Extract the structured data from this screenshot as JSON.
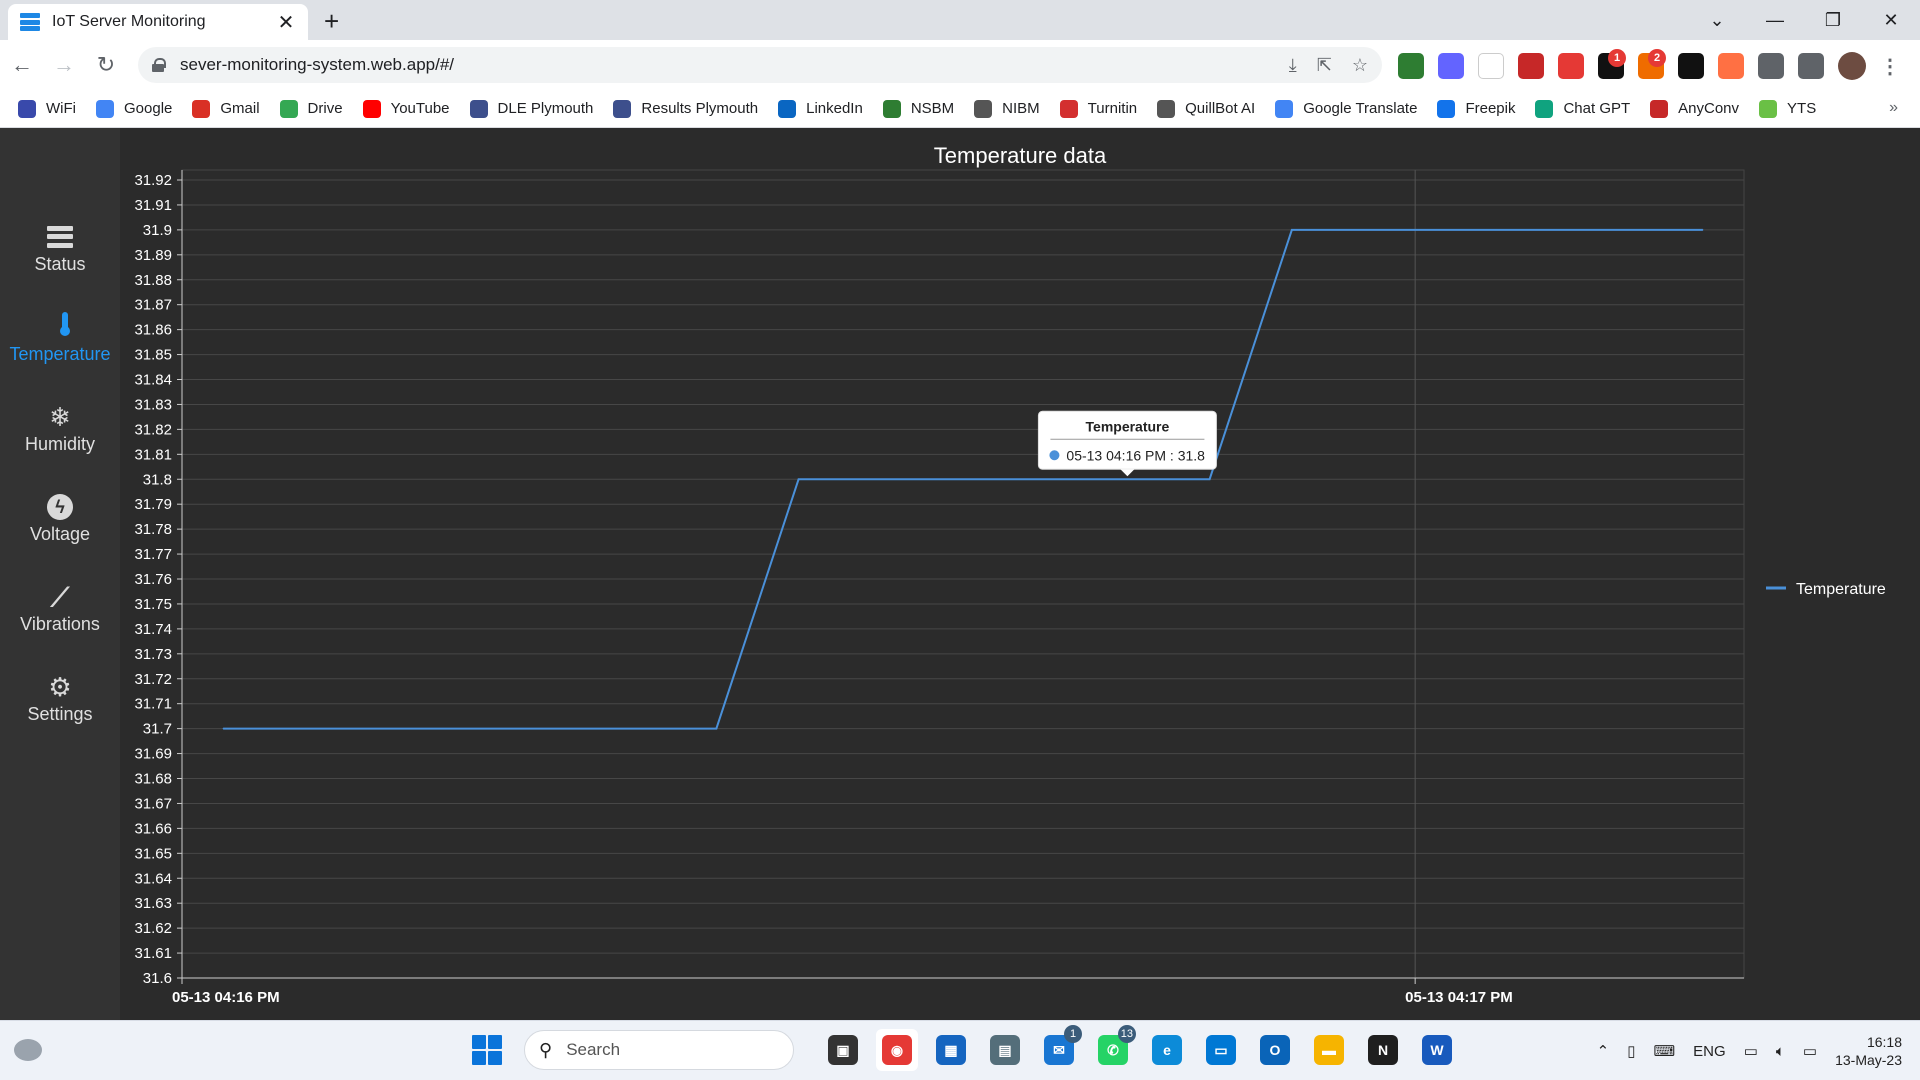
{
  "browser": {
    "tab_title": "IoT Server Monitoring",
    "tab_close": "✕",
    "new_tab": "+",
    "url": "sever-monitoring-system.web.app/#/",
    "window_controls": [
      "⌄",
      "—",
      "❐",
      "✕"
    ],
    "extensions": [
      {
        "icon": "globe-extension-icon",
        "color": "#2e7d32"
      },
      {
        "icon": "mastodon-icon",
        "color": "#6364ff"
      },
      {
        "icon": "notion-n-icon",
        "color": "#ffffff"
      },
      {
        "icon": "video-icon",
        "color": "#c62828"
      },
      {
        "icon": "adblock-icon",
        "color": "#e53935"
      },
      {
        "icon": "black-ext-icon",
        "color": "#111111",
        "badge": "1"
      },
      {
        "icon": "orange-ext-icon",
        "color": "#ef6c00",
        "badge": "2"
      },
      {
        "icon": "chatgpt-ext-icon",
        "color": "#111111"
      },
      {
        "icon": "brave-icon",
        "color": "#ff7043"
      },
      {
        "icon": "puzzle-icon",
        "color": "#5f6368"
      },
      {
        "icon": "sidepanel-icon",
        "color": "#5f6368"
      }
    ],
    "bookmarks": [
      {
        "label": "WiFi",
        "icon": "wifi-icon",
        "color": "#3949ab"
      },
      {
        "label": "Google",
        "icon": "google-icon",
        "color": "#4285f4"
      },
      {
        "label": "Gmail",
        "icon": "gmail-icon",
        "color": "#d93025"
      },
      {
        "label": "Drive",
        "icon": "drive-icon",
        "color": "#34a853"
      },
      {
        "label": "YouTube",
        "icon": "youtube-icon",
        "color": "#ff0000"
      },
      {
        "label": "DLE Plymouth",
        "icon": "plymouth-crest-icon",
        "color": "#3d4f8c"
      },
      {
        "label": "Results Plymouth",
        "icon": "plymouth-crest-icon",
        "color": "#3d4f8c"
      },
      {
        "label": "LinkedIn",
        "icon": "linkedin-icon",
        "color": "#0a66c2"
      },
      {
        "label": "NSBM",
        "icon": "nsbm-icon",
        "color": "#2e7d32"
      },
      {
        "label": "NIBM",
        "icon": "nibm-icon",
        "color": "#555555"
      },
      {
        "label": "Turnitin",
        "icon": "turnitin-icon",
        "color": "#d32f2f"
      },
      {
        "label": "QuillBot AI",
        "icon": "quill-icon",
        "color": "#555555"
      },
      {
        "label": "Google Translate",
        "icon": "translate-icon",
        "color": "#4285f4"
      },
      {
        "label": "Freepik",
        "icon": "freepik-icon",
        "color": "#1273eb"
      },
      {
        "label": "Chat GPT",
        "icon": "chatgpt-icon",
        "color": "#10a37f"
      },
      {
        "label": "AnyConv",
        "icon": "anyconv-icon",
        "color": "#c62828"
      },
      {
        "label": "YTS",
        "icon": "yts-icon",
        "color": "#6ac045"
      }
    ],
    "bookmarks_more": "»"
  },
  "sidebar": {
    "items": [
      {
        "label": "Status",
        "icon": "server-icon",
        "active": false
      },
      {
        "label": "Temperature",
        "icon": "thermometer-icon",
        "active": true
      },
      {
        "label": "Humidity",
        "icon": "snowflake-icon",
        "glyph": "❄",
        "active": false
      },
      {
        "label": "Voltage",
        "icon": "bolt-icon",
        "glyph": "ϟ",
        "active": false
      },
      {
        "label": "Vibrations",
        "icon": "trend-icon",
        "glyph": "⟋",
        "active": false
      },
      {
        "label": "Settings",
        "icon": "gear-icon",
        "glyph": "⚙",
        "active": false
      }
    ],
    "active_color": "#2196f3"
  },
  "chart_data": {
    "type": "line",
    "title": "Temperature data",
    "xlabel": "",
    "ylabel": "",
    "ylim": [
      31.6,
      31.92
    ],
    "yticks": [
      "31.92",
      "31.91",
      "31.9",
      "31.89",
      "31.88",
      "31.87",
      "31.86",
      "31.85",
      "31.84",
      "31.83",
      "31.82",
      "31.81",
      "31.8",
      "31.79",
      "31.78",
      "31.77",
      "31.76",
      "31.75",
      "31.74",
      "31.73",
      "31.72",
      "31.71",
      "31.7",
      "31.69",
      "31.68",
      "31.67",
      "31.66",
      "31.65",
      "31.64",
      "31.63",
      "31.62",
      "31.61",
      "31.6"
    ],
    "xticks": [
      {
        "label": "05-13 04:16 PM",
        "t": 0
      },
      {
        "label": "05-13 04:17 PM",
        "t": 60
      }
    ],
    "x_unit": "seconds after 05-13 04:16 PM",
    "xlim": [
      0,
      76
    ],
    "series": [
      {
        "name": "Temperature",
        "color": "#4a90d9",
        "x": [
          2,
          26,
          30,
          50,
          54,
          74
        ],
        "y": [
          31.7,
          31.7,
          31.8,
          31.8,
          31.9,
          31.9
        ]
      }
    ],
    "legend": "right",
    "grid": true,
    "tooltip": {
      "title": "Temperature",
      "text": "05-13 04:16 PM : 31.8",
      "x": 46,
      "y": 31.8
    }
  },
  "taskbar": {
    "search_label": "Search",
    "apps": [
      {
        "name": "task-view-icon",
        "color": "#333333",
        "glyph": "▣"
      },
      {
        "name": "chrome-icon",
        "color": "#e53935",
        "glyph": "◉",
        "active": true
      },
      {
        "name": "store-icon",
        "color": "#1565c0",
        "glyph": "▦"
      },
      {
        "name": "calculator-icon",
        "color": "#546e7a",
        "glyph": "▤"
      },
      {
        "name": "mail-icon",
        "color": "#1976d2",
        "glyph": "✉",
        "badge": "1"
      },
      {
        "name": "whatsapp-icon",
        "color": "#25d366",
        "glyph": "✆",
        "badge": "13"
      },
      {
        "name": "edge-icon",
        "color": "#0c8bd8",
        "glyph": "e"
      },
      {
        "name": "remote-desktop-icon",
        "color": "#0078d4",
        "glyph": "▭"
      },
      {
        "name": "outlook-icon",
        "color": "#0a64b8",
        "glyph": "O"
      },
      {
        "name": "file-explorer-icon",
        "color": "#f6b400",
        "glyph": "▬"
      },
      {
        "name": "notion-icon",
        "color": "#1f1f1f",
        "glyph": "N"
      },
      {
        "name": "word-icon",
        "color": "#185abd",
        "glyph": "W"
      }
    ],
    "tray": {
      "chevron": "⌃",
      "language": "ENG",
      "time": "16:18",
      "date": "13-May-23"
    }
  }
}
